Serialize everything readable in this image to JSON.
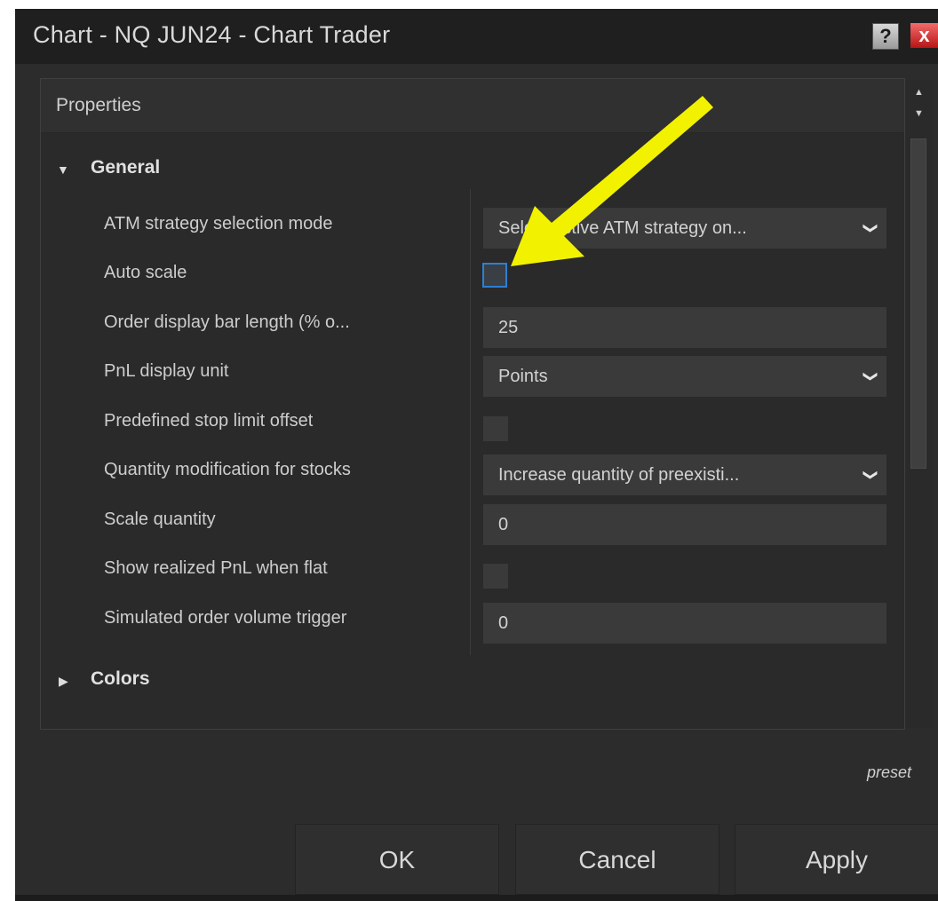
{
  "window": {
    "title": "Chart - NQ JUN24 - Chart Trader"
  },
  "titlebar_buttons": {
    "help": "?",
    "close": "x"
  },
  "panel": {
    "header": "Properties"
  },
  "sections": {
    "general": {
      "label": "General",
      "toggle": "▼"
    },
    "colors": {
      "label": "Colors",
      "toggle": "▶"
    }
  },
  "properties": {
    "atm_mode": {
      "label": "ATM strategy selection mode",
      "value": "Select active ATM strategy on..."
    },
    "auto_scale": {
      "label": "Auto scale",
      "checked": false
    },
    "order_bar_length": {
      "label": "Order display bar length (% o...",
      "value": "25"
    },
    "pnl_unit": {
      "label": "PnL display unit",
      "value": "Points"
    },
    "predef_stop": {
      "label": "Predefined stop limit offset",
      "checked": false
    },
    "qty_mod": {
      "label": "Quantity modification for stocks",
      "value": "Increase quantity of preexisti..."
    },
    "scale_qty": {
      "label": "Scale quantity",
      "value": "0"
    },
    "show_pnl_flat": {
      "label": "Show realized PnL when flat",
      "checked": false
    },
    "sim_trigger": {
      "label": "Simulated order volume trigger",
      "value": "0"
    }
  },
  "footer": {
    "preset": "preset"
  },
  "buttons": {
    "ok": "OK",
    "cancel": "Cancel",
    "apply": "Apply"
  },
  "colors": {
    "background": "#2c2c2c",
    "field": "#3a3a3a",
    "focus": "#2d7fd3",
    "arrow": "#f2f200"
  }
}
